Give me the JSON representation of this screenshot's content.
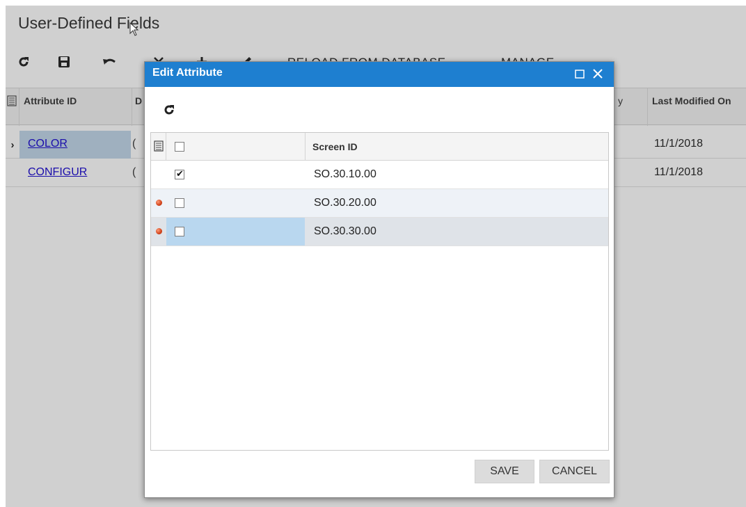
{
  "page": {
    "title": "User-Defined Fields"
  },
  "toolbar": {
    "refresh_icon": "refresh-icon",
    "save_icon": "save-icon",
    "undo_icon": "undo-icon",
    "reload_label": "RELOAD FROM DATABASE",
    "manage_label": "MANAGE"
  },
  "grid": {
    "columns": [
      "Attribute ID",
      "D",
      "y",
      "Last Modified On"
    ],
    "rows": [
      {
        "id": "COLOR",
        "d": "(",
        "last_modified": "11/1/2018",
        "active": true
      },
      {
        "id": "CONFIGUR",
        "d": "(",
        "last_modified": "11/1/2018",
        "active": false
      }
    ]
  },
  "modal": {
    "title": "Edit Attribute",
    "maximize_icon": "maximize-icon",
    "close_icon": "close-icon",
    "column_header": "Screen ID",
    "rows": [
      {
        "screen_id": "SO.30.10.00",
        "checked": true,
        "modified": false
      },
      {
        "screen_id": "SO.30.20.00",
        "checked": false,
        "modified": true
      },
      {
        "screen_id": "SO.30.30.00",
        "checked": false,
        "modified": true
      }
    ],
    "save_label": "SAVE",
    "cancel_label": "CANCEL"
  },
  "colors": {
    "header_blue": "#1e7fd0",
    "link": "#1a0dab",
    "selected_cell": "#b9d7ef"
  }
}
